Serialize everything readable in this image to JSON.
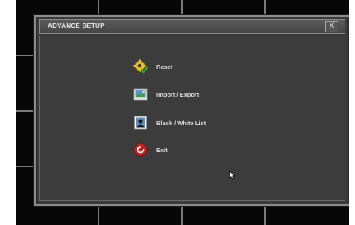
{
  "dialog": {
    "title": "ADVANCE SETUP",
    "close_label": "X"
  },
  "menu": {
    "items": [
      {
        "label": "Reset",
        "icon": "reset-icon"
      },
      {
        "label": "Import / Export",
        "icon": "import-export-icon"
      },
      {
        "label": "Black / White List",
        "icon": "black-white-list-icon"
      },
      {
        "label": "Exit",
        "icon": "exit-icon"
      }
    ]
  },
  "colors": {
    "screen_background": "#070707",
    "dialog_background": "#3a3a3a",
    "text": "#dcdcdc",
    "exit_red": "#c41e1e",
    "reset_yellow": "#e8c02a",
    "reset_green": "#3fa62c"
  }
}
